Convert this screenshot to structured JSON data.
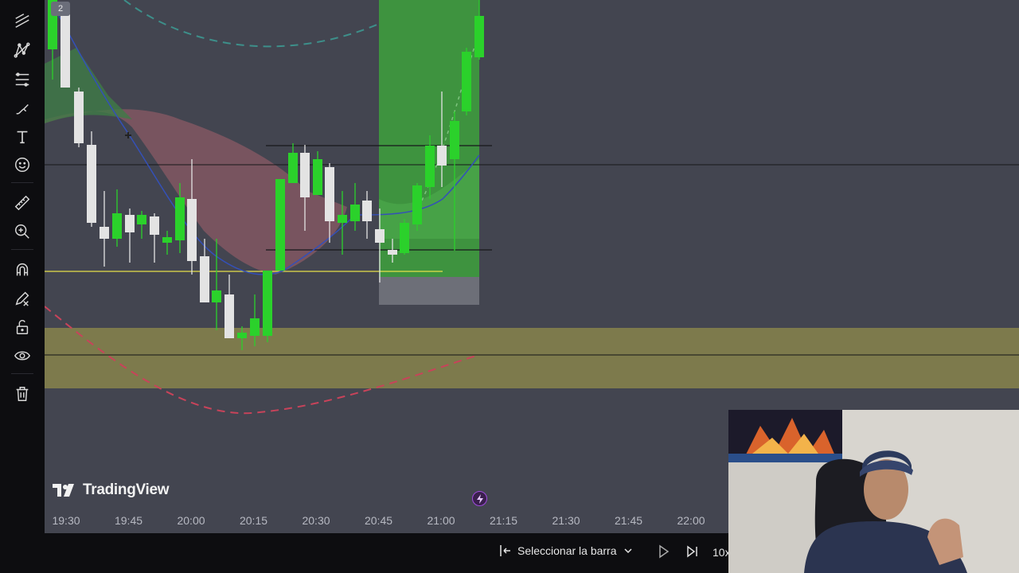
{
  "toolbar": {
    "tools": [
      "trend-lines-icon",
      "pattern-icon",
      "fib-retracement-icon",
      "brush-icon",
      "text-icon",
      "emoji-icon",
      "ruler-icon",
      "zoom-in-icon",
      "magnet-icon",
      "stay-in-drawing-icon",
      "lock-icon",
      "eye-icon",
      "trash-icon"
    ]
  },
  "chart": {
    "brand": "TradingView",
    "counter_badge": "2",
    "time_axis": [
      "19:30",
      "19:45",
      "20:00",
      "20:15",
      "20:30",
      "20:45",
      "21:00",
      "21:15",
      "21:30",
      "21:45",
      "22:00"
    ],
    "colors": {
      "background": "#434550",
      "bull": "#2bd12b",
      "bear": "#e3e3e3",
      "zone": "#7d7a4c"
    }
  },
  "replay": {
    "select_bar": "Seleccionar la barra",
    "speed": "10x"
  },
  "webcam": {
    "label": "presenter-webcam"
  }
}
